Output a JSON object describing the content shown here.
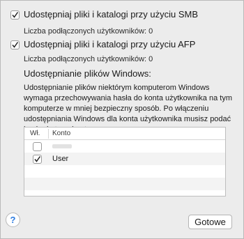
{
  "smb": {
    "label": "Udostępniaj pliki i katalogi przy użyciu SMB",
    "checked": true,
    "count_label": "Liczba podłączonych użytkowników: 0"
  },
  "afp": {
    "label": "Udostępniaj pliki i katalogi przy użyciu AFP",
    "checked": true,
    "count_label": "Liczba podłączonych użytkowników: 0"
  },
  "windows": {
    "heading": "Udostępnianie plików Windows:",
    "description": "Udostępnianie plików niektórym komputerom Windows wymaga przechowywania hasła do konta użytkownika na tym komputerze w mniej bezpieczny sposób. Po włączeniu udostępniania Windows dla konta użytkownika musisz podać hasło do tego konta."
  },
  "table": {
    "col_enabled": "Wł.",
    "col_account": "Konto",
    "rows": [
      {
        "enabled": false,
        "account": ""
      },
      {
        "enabled": true,
        "account": "User"
      }
    ]
  },
  "help": {
    "label": "?"
  },
  "done_button": {
    "label": "Gotowe"
  }
}
